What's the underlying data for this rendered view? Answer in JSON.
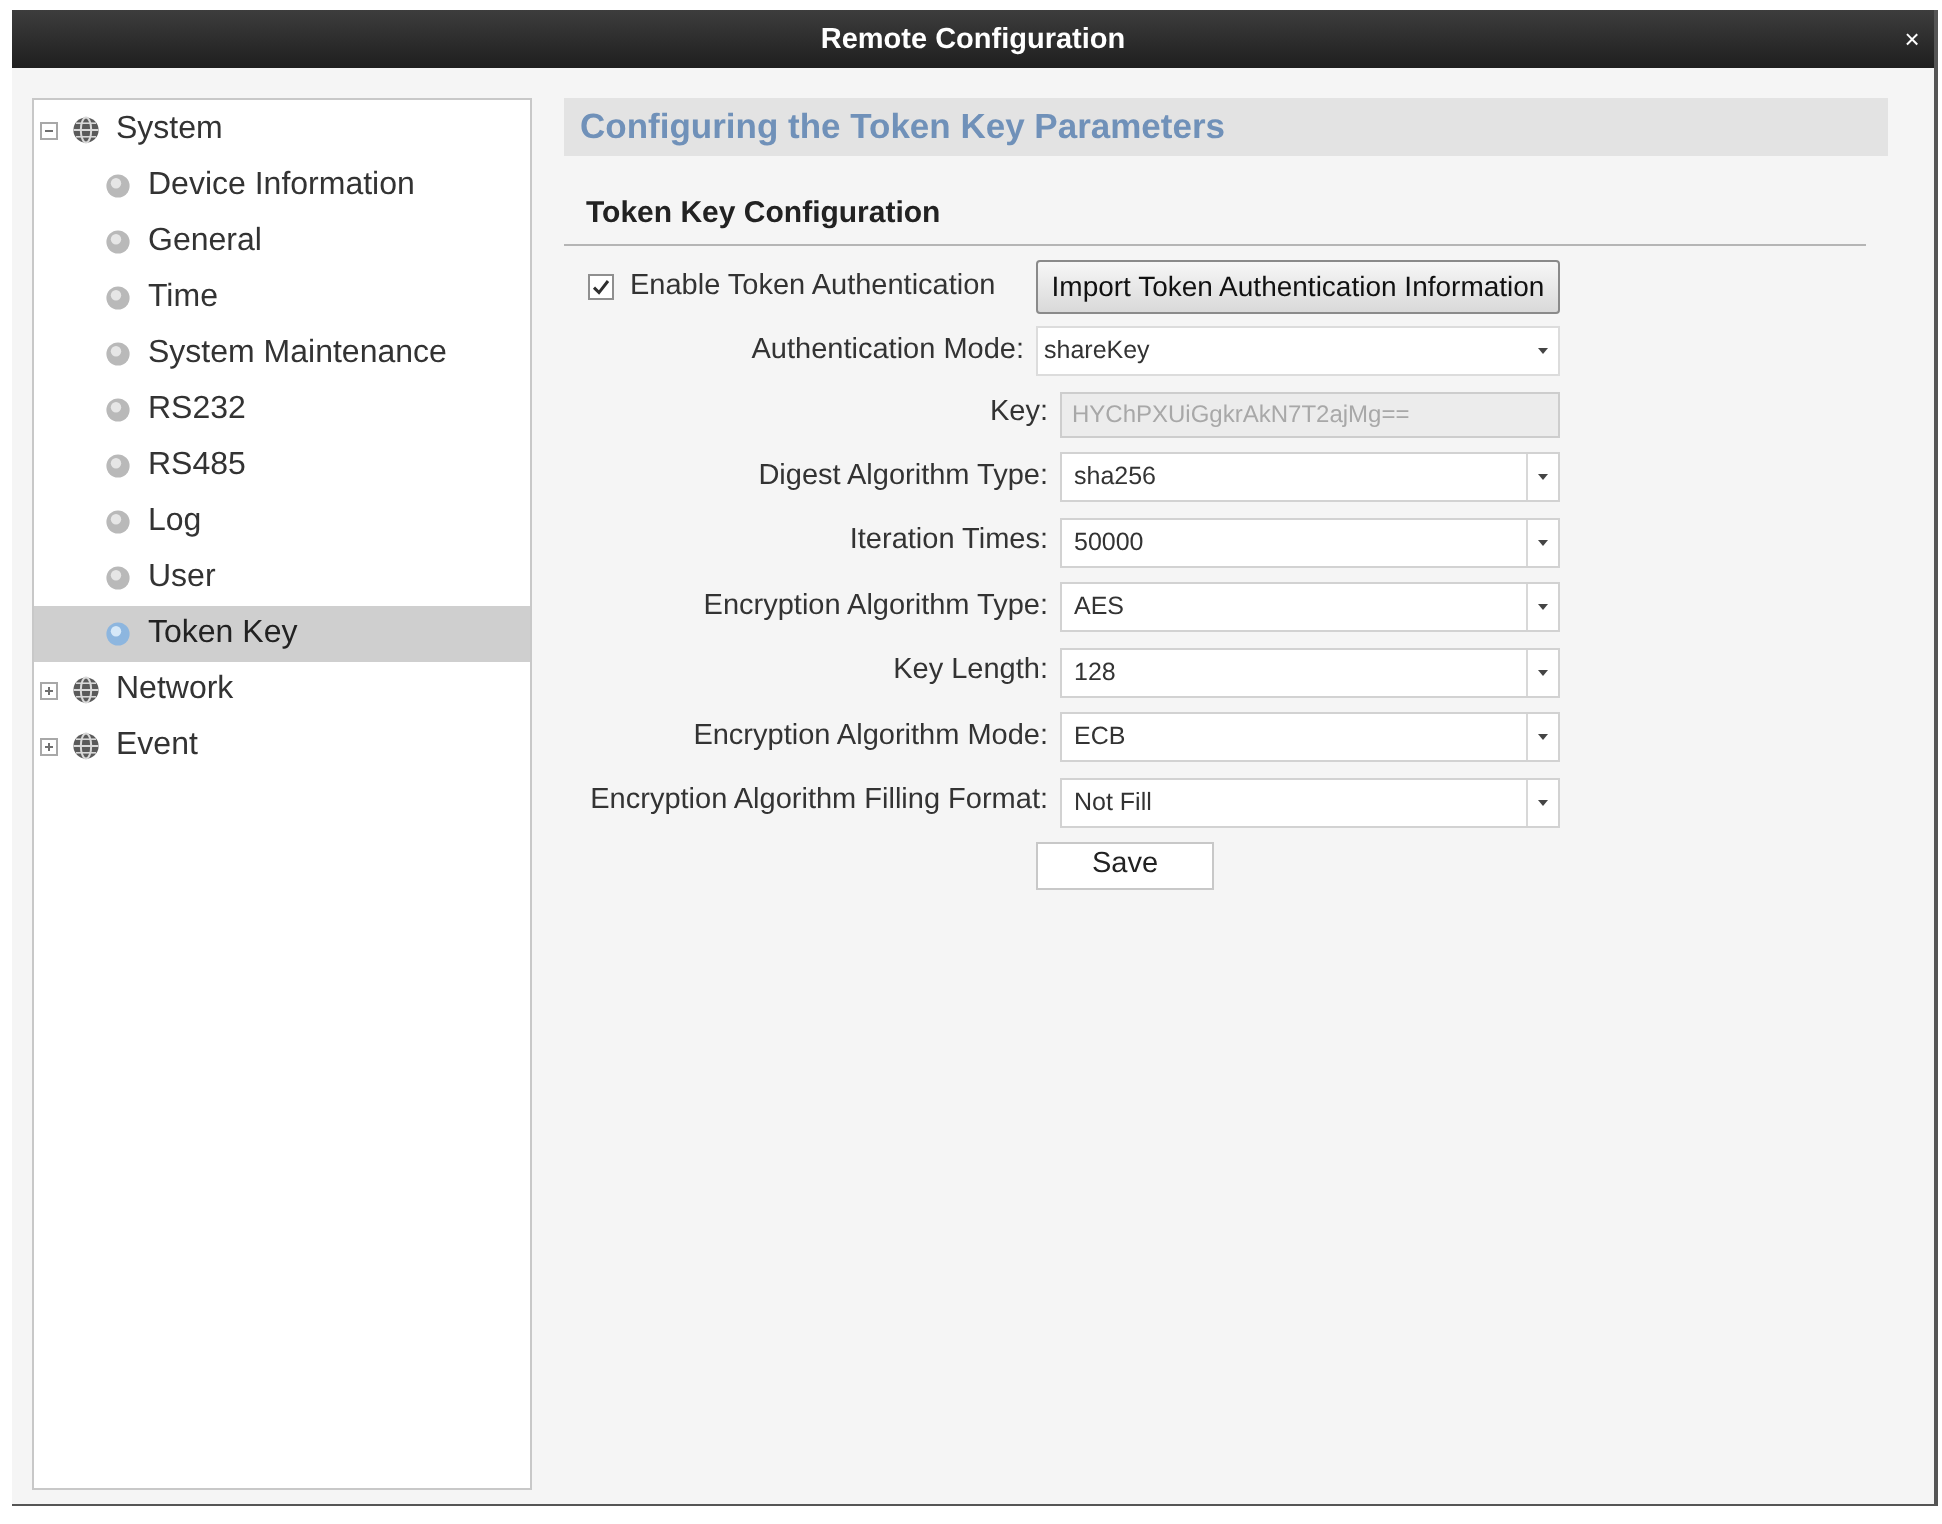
{
  "window": {
    "title": "Remote Configuration",
    "close": "×"
  },
  "sidebar": {
    "items": [
      {
        "label": "System",
        "expanded": true,
        "selected": false,
        "children": [
          {
            "label": "Device Information",
            "selected": false
          },
          {
            "label": "General",
            "selected": false
          },
          {
            "label": "Time",
            "selected": false
          },
          {
            "label": "System Maintenance",
            "selected": false
          },
          {
            "label": "RS232",
            "selected": false
          },
          {
            "label": "RS485",
            "selected": false
          },
          {
            "label": "Log",
            "selected": false
          },
          {
            "label": "User",
            "selected": false
          },
          {
            "label": "Token Key",
            "selected": true
          }
        ]
      },
      {
        "label": "Network",
        "expanded": false,
        "selected": false
      },
      {
        "label": "Event",
        "expanded": false,
        "selected": false
      }
    ]
  },
  "content": {
    "title": "Configuring the Token Key Parameters",
    "section_title": "Token Key Configuration",
    "enable": {
      "label": "Enable Token Authentication",
      "checked": true
    },
    "import_button": "Import Token Authentication Information",
    "fields": [
      {
        "kind": "combo",
        "label": "Authentication Mode:",
        "value": "shareKey",
        "disabled": false
      },
      {
        "kind": "text",
        "label": "Key:",
        "value": "HYChPXUiGgkrAkN7T2ajMg==",
        "disabled": true
      },
      {
        "kind": "select",
        "label": "Digest Algorithm Type:",
        "value": "sha256",
        "disabled": false
      },
      {
        "kind": "select",
        "label": "Iteration Times:",
        "value": "50000",
        "disabled": false
      },
      {
        "kind": "select",
        "label": "Encryption Algorithm Type:",
        "value": "AES",
        "disabled": false
      },
      {
        "kind": "select",
        "label": "Key Length:",
        "value": "128",
        "disabled": false
      },
      {
        "kind": "select",
        "label": "Encryption Algorithm Mode:",
        "value": "ECB",
        "disabled": false
      },
      {
        "kind": "select",
        "label": "Encryption Algorithm Filling Format:",
        "value": "Not Fill",
        "disabled": false
      }
    ],
    "save_button": "Save"
  }
}
